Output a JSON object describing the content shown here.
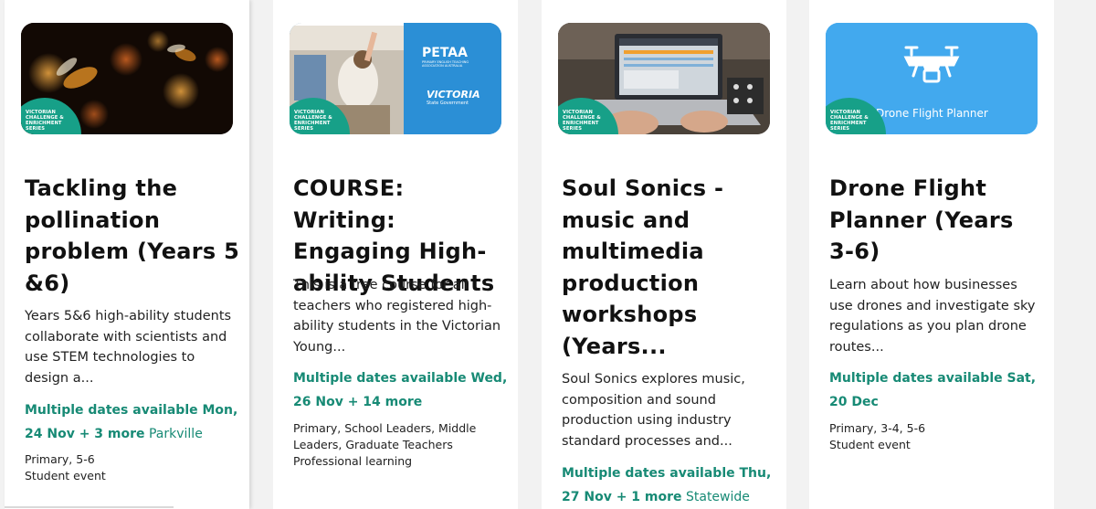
{
  "cards": [
    {
      "badge": "VICTORIAN\nCHALLENGE &\nENRICHMENT\nSERIES",
      "title": "Tackling the pollination problem (Years 5 &6)",
      "description": "Years 5&6 high-ability students collaborate with scientists and use STEM technologies to design a...",
      "dates_text": "Multiple dates available Mon, 24 Nov + 3 more",
      "location": "Parkville",
      "audience": "Primary, 5-6",
      "event_type": "Student event"
    },
    {
      "badge": "VICTORIAN\nCHALLENGE &\nENRICHMENT\nSERIES",
      "logo_petaa": "PETAA",
      "logo_petaa_sub": "PRIMARY ENGLISH TEACHING ASSOCIATION AUSTRALIA",
      "logo_victoria": "VICTORIA",
      "logo_victoria_sub": "State Government",
      "title": "COURSE: Writing: Engaging High-ability Students",
      "description": "This is a free course for all teachers who registered high-ability students in the Victorian Young...",
      "dates_text": "Multiple dates available Wed, 26 Nov + 14 more",
      "location": "",
      "audience": "Primary, School Leaders, Middle Leaders, Graduate Teachers",
      "event_type": "Professional learning"
    },
    {
      "badge": "VICTORIAN\nCHALLENGE &\nENRICHMENT\nSERIES",
      "title": "Soul Sonics - music and multimedia production workshops (Years...",
      "description": "Soul Sonics explores music, composition and sound production using industry standard processes and...",
      "dates_text": "Multiple dates available Thu, 27 Nov + 1 more",
      "location": "Statewide",
      "audience": "",
      "event_type": ""
    },
    {
      "badge": "VICTORIAN\nCHALLENGE &\nENRICHMENT\nSERIES",
      "thumb_title": "Drone Flight Planner",
      "title": "Drone Flight Planner (Years 3-6)",
      "description": "Learn about how businesses use drones and investigate sky regulations as you plan drone routes...",
      "dates_text": "Multiple dates available Sat, 20 Dec",
      "location": "",
      "audience": "Primary, 3-4, 5-6",
      "event_type": "Student event"
    }
  ],
  "colors": {
    "accent": "#178a75",
    "badge": "#17a088",
    "drone_bg": "#42a9ee",
    "petaa_bg": "#2b8fd6"
  },
  "icons": [
    "bee-photo",
    "classroom-photo",
    "laptop-photo",
    "drone-icon"
  ]
}
